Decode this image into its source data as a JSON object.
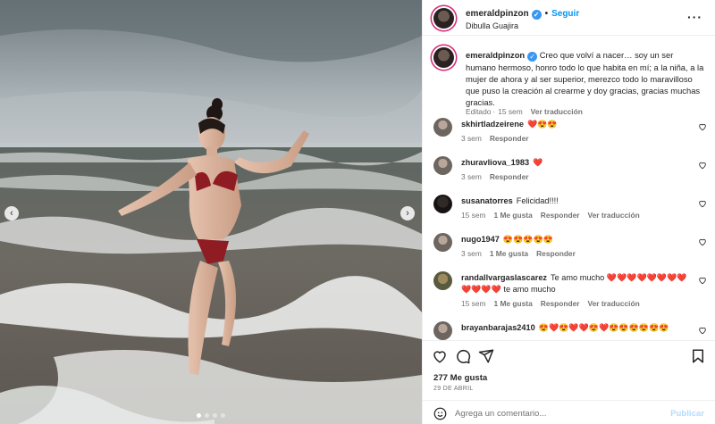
{
  "post": {
    "username": "emeraldpinzon",
    "follow_label": "Seguir",
    "location": "Dibulla Guajira",
    "caption_text": "Creo que volví a nacer… soy un ser humano hermoso, honro todo lo que habita en mí; a la niña, a la mujer de ahora y al ser superior, merezco todo lo maravilloso que puso la creación al crearme y doy gracias, gracias muchas gracias.",
    "caption_meta": {
      "edited": "Editado",
      "time": "15 sem",
      "translate": "Ver traducción"
    },
    "likes": "277 Me gusta",
    "date": "29 DE ABRIL",
    "slide_index": 1,
    "slide_count": 4
  },
  "comments": [
    {
      "user": "skhirtladzeirene",
      "text": "",
      "emoji": "❤️😍😍",
      "time": "3 sem",
      "likes": "",
      "reply": "Responder",
      "translate": ""
    },
    {
      "user": "zhuravliova_1983",
      "text": "",
      "emoji": "❤️",
      "time": "3 sem",
      "likes": "",
      "reply": "Responder",
      "translate": ""
    },
    {
      "user": "susanatorres",
      "text": "Felicidad!!!!",
      "emoji": "",
      "time": "15 sem",
      "likes": "1 Me gusta",
      "reply": "Responder",
      "translate": "Ver traducción"
    },
    {
      "user": "nugo1947",
      "text": "",
      "emoji": "😍😍😍😍😍",
      "time": "3 sem",
      "likes": "1 Me gusta",
      "reply": "Responder",
      "translate": ""
    },
    {
      "user": "randallvargaslascarez",
      "text": "Te amo mucho",
      "emoji": "❤️❤️❤️❤️❤️❤️❤️❤️❤️❤️❤️❤️",
      "text2": "te amo mucho",
      "emoji2": "❤️❤️❤️❤️❤️❤️❤️❤️❤️❤️❤️❤️❤️❤️",
      "time": "15 sem",
      "likes": "1 Me gusta",
      "reply": "Responder",
      "translate": "Ver traducción"
    },
    {
      "user": "brayanbarajas2410",
      "text": "",
      "emoji": "😍❤️😍❤️❤️😍❤️😍😍😍😍😍😍",
      "time": "",
      "likes": "",
      "reply": "",
      "translate": ""
    }
  ],
  "composer": {
    "placeholder": "Agrega un comentario...",
    "publish_label": "Publicar"
  },
  "colors": {
    "accent": "#0095f6",
    "verified": "#3897f0",
    "heart": "#ed4956",
    "secondary_text": "#737373"
  },
  "icons": [
    "more-options-icon",
    "heart-icon",
    "comment-icon",
    "share-icon",
    "bookmark-icon",
    "emoji-icon",
    "chevron-left-icon",
    "chevron-right-icon",
    "verified-badge-icon"
  ]
}
